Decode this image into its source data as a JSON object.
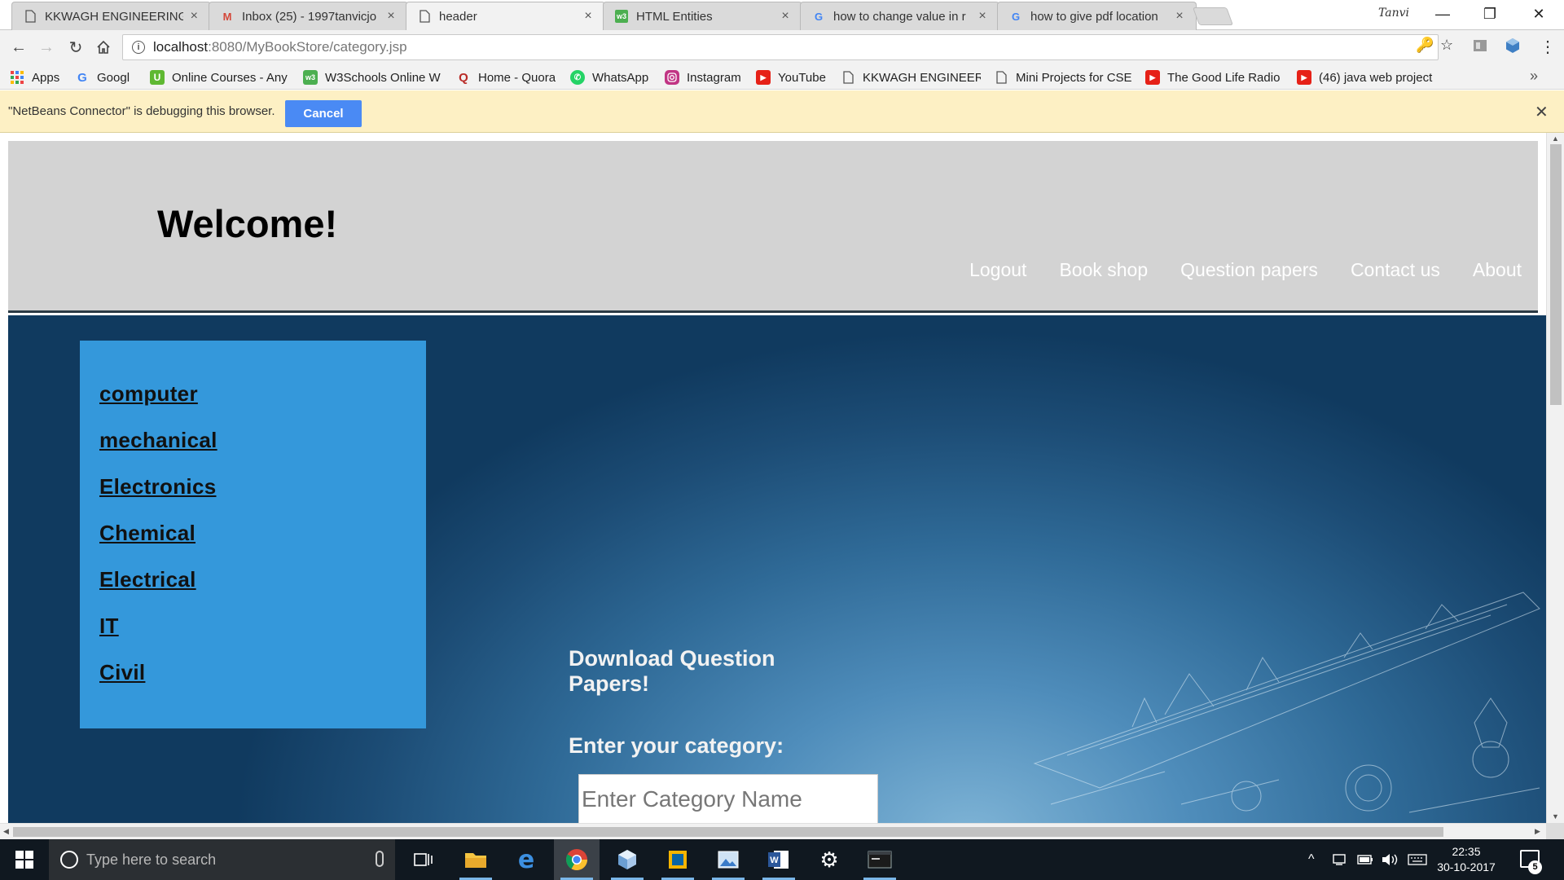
{
  "browser": {
    "tabs": [
      {
        "title": "KKWAGH ENGINEERING",
        "icon": "page-icon",
        "active": false
      },
      {
        "title": "Inbox (25) - 1997tanvicjo",
        "icon": "gmail-icon",
        "active": false
      },
      {
        "title": "header",
        "icon": "page-icon",
        "active": true
      },
      {
        "title": "HTML Entities",
        "icon": "w3schools-icon",
        "active": false
      },
      {
        "title": "how to change value in r",
        "icon": "google-icon",
        "active": false
      },
      {
        "title": "how to give pdf location",
        "icon": "google-icon",
        "active": false
      }
    ],
    "profile_name": "Tanvi",
    "url_host": "localhost",
    "url_path": ":8080/MyBookStore/category.jsp",
    "bookmarks": [
      {
        "label": "Apps",
        "icon": "apps-grid-icon"
      },
      {
        "label": "Googl",
        "icon": "google-icon"
      },
      {
        "label": "Online Courses - Any",
        "icon": "udemy-icon"
      },
      {
        "label": "W3Schools Online W",
        "icon": "w3schools-icon"
      },
      {
        "label": "Home - Quora",
        "icon": "quora-icon"
      },
      {
        "label": "WhatsApp",
        "icon": "whatsapp-icon"
      },
      {
        "label": "Instagram",
        "icon": "instagram-icon"
      },
      {
        "label": "YouTube",
        "icon": "youtube-icon"
      },
      {
        "label": "KKWAGH ENGINEERI",
        "icon": "page-icon"
      },
      {
        "label": "Mini Projects for CSE",
        "icon": "page-icon"
      },
      {
        "label": "The Good Life Radio",
        "icon": "youtube-icon"
      },
      {
        "label": "(46) java web project",
        "icon": "youtube-icon"
      }
    ],
    "more_bookmarks": "»",
    "infobar": {
      "message": "\"NetBeans Connector\" is debugging this browser.",
      "cancel_label": "Cancel"
    }
  },
  "page": {
    "welcome": "Welcome!",
    "nav": [
      "Logout",
      "Book shop",
      "Question papers",
      "Contact us",
      "About"
    ],
    "categories": [
      "computer",
      "mechanical",
      "Electronics",
      "Chemical",
      "Electrical",
      "IT",
      "Civil"
    ],
    "download_title": "Download Question Papers!",
    "category_label": "Enter your category:",
    "category_input_placeholder": "Enter Category Name"
  },
  "taskbar": {
    "search_placeholder": "Type here to search",
    "time": "22:35",
    "date": "30-10-2017",
    "notification_count": "5"
  },
  "colors": {
    "header_bg": "#d3d3d3",
    "sidebar_bg": "#3498db",
    "cancel_button": "#4a8af4",
    "infobar_bg": "#fdf0c4"
  }
}
